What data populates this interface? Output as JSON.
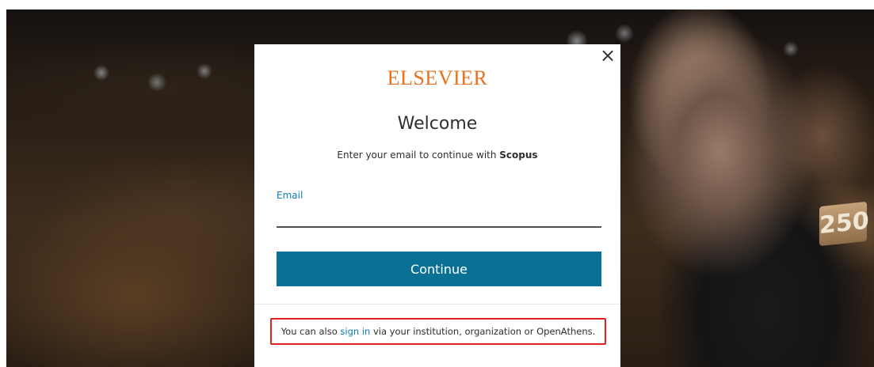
{
  "background": {
    "seat_number": "250"
  },
  "modal": {
    "close_icon": "×",
    "logo_text": "ELSEVIER",
    "title": "Welcome",
    "subtitle_prefix": "Enter your email to continue with ",
    "subtitle_product": "Scopus",
    "email_label": "Email",
    "email_value": "",
    "continue_label": "Continue",
    "alt_prefix": "You can also ",
    "alt_link": "sign in",
    "alt_suffix": " via your institution, organization or OpenAthens."
  },
  "colors": {
    "brand_orange": "#e9711c",
    "button_teal": "#0a7194",
    "link_blue": "#0c7dbb",
    "highlight_red": "#e02020"
  }
}
